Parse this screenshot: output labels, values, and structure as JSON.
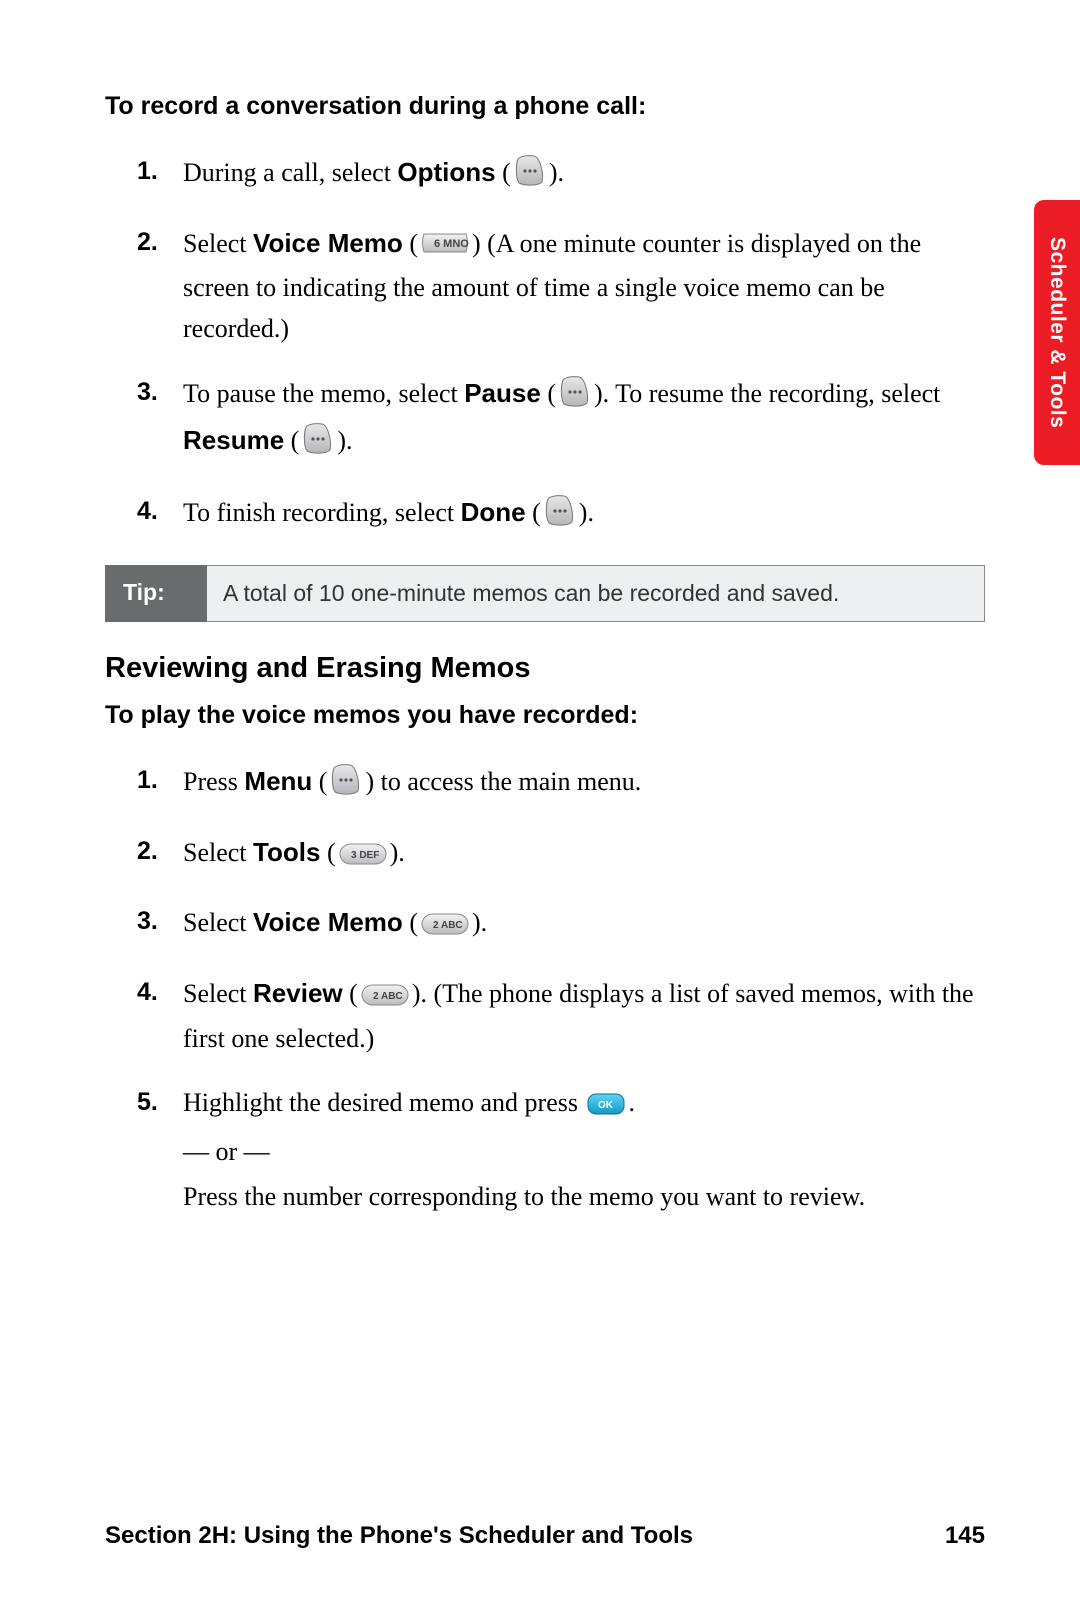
{
  "sideTab": "Scheduler & Tools",
  "intro1": "To record a conversation during a phone call:",
  "list1": {
    "n1": "1.",
    "i1a": "During a call, select ",
    "i1b": "Options",
    "i1c": " (",
    "i1d": ").",
    "n2": "2.",
    "i2a": "Select ",
    "i2b": "Voice Memo",
    "i2c": " (",
    "i2d": ") (A one minute counter is displayed on the screen to indicating the amount of time a single voice memo can be recorded.)",
    "n3": "3.",
    "i3a": "To pause the memo, select ",
    "i3b": "Pause",
    "i3c": " (",
    "i3d": "). To resume the recording, select ",
    "i3e": "Resume",
    "i3f": " (",
    "i3g": ").",
    "n4": "4.",
    "i4a": "To finish recording, select ",
    "i4b": "Done",
    "i4c": " (",
    "i4d": ")."
  },
  "tipLabel": "Tip:",
  "tipBody": "A total of 10 one-minute memos can be recorded and saved.",
  "heading2": "Reviewing and Erasing Memos",
  "intro2": "To play the voice memos you have recorded:",
  "list2": {
    "n1": "1.",
    "i1a": "Press ",
    "i1b": "Menu",
    "i1c": " (",
    "i1d": ") to access the main menu.",
    "n2": "2.",
    "i2a": "Select ",
    "i2b": "Tools",
    "i2c": " (",
    "i2d": ").",
    "n3": "3.",
    "i3a": "Select ",
    "i3b": "Voice Memo",
    "i3c": " (",
    "i3d": ").",
    "n4": "4.",
    "i4a": "Select ",
    "i4b": "Review",
    "i4c": " (",
    "i4d": "). (The phone displays a list of saved memos, with the first one selected.)",
    "n5": "5.",
    "i5a": "Highlight the desired memo and press ",
    "i5b": ".",
    "i5or": "— or —",
    "i5c": "Press the number corresponding to the memo you want to review."
  },
  "keys": {
    "k6": "6 MNO",
    "k3": "3 DEF",
    "k2": "2 ABC",
    "ok": "OK"
  },
  "footerLeft": "Section 2H: Using the Phone's Scheduler and Tools",
  "footerRight": "145"
}
